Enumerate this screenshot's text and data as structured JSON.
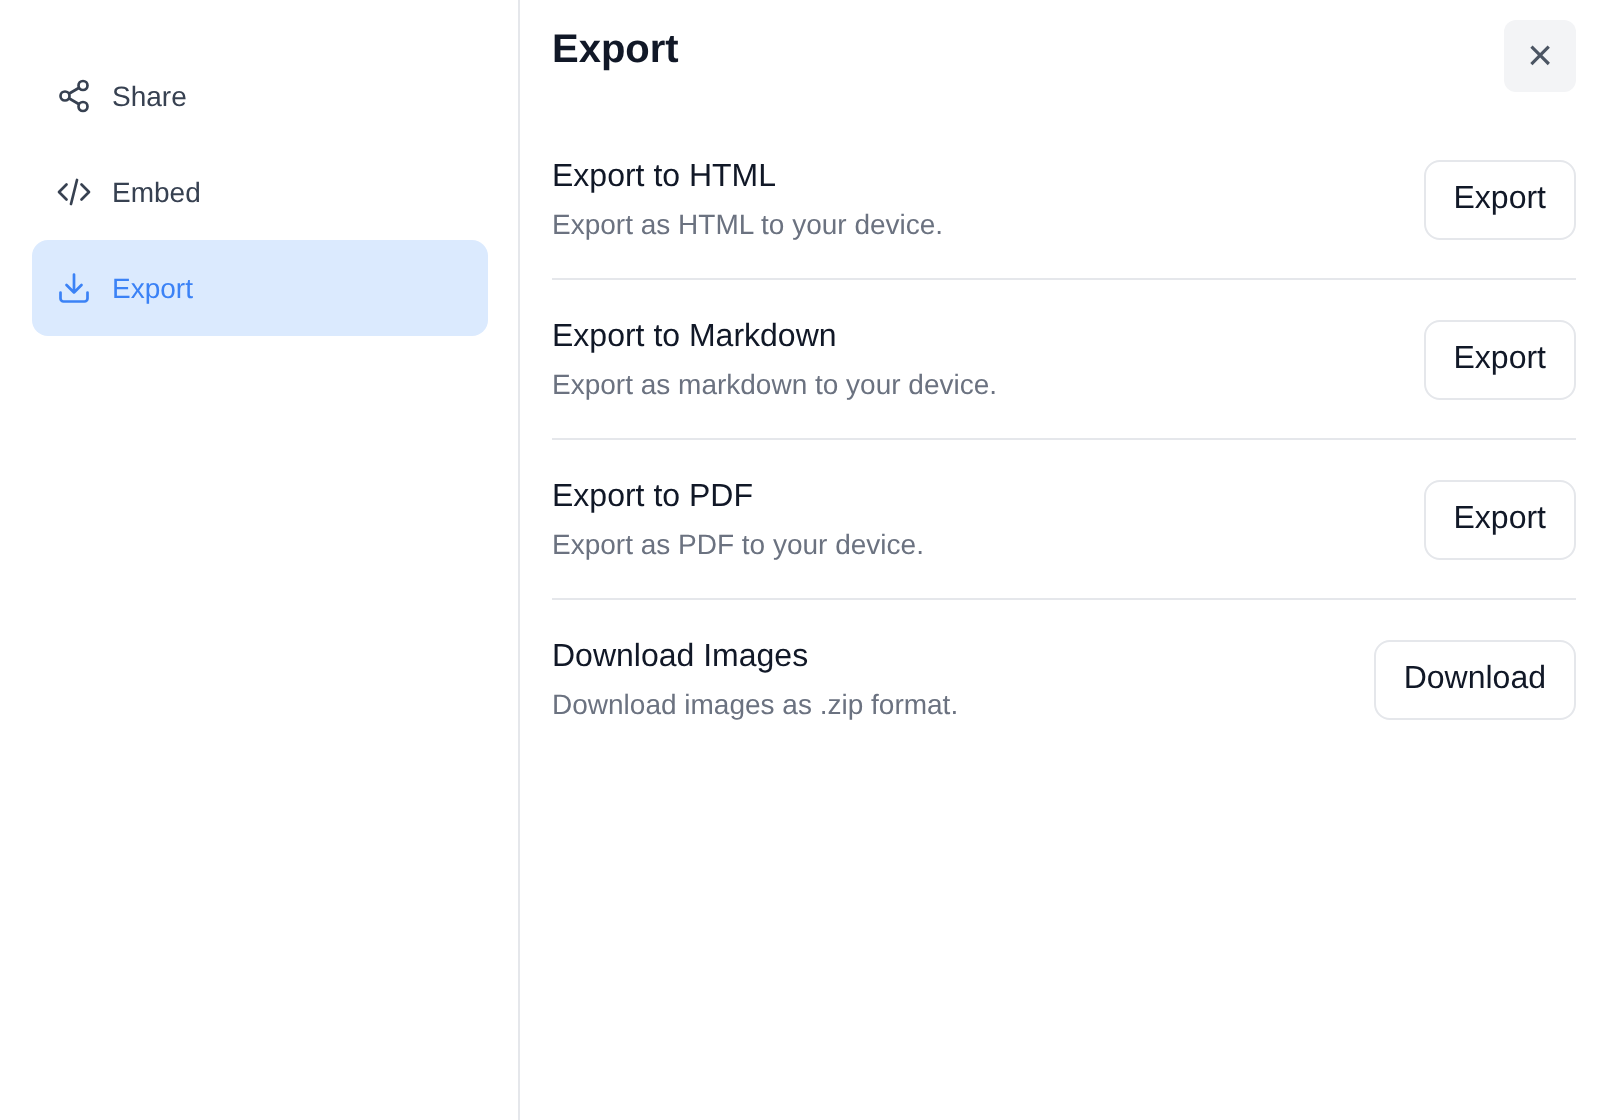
{
  "sidebar": {
    "items": [
      {
        "label": "Share",
        "kind": "share",
        "selected": false
      },
      {
        "label": "Embed",
        "kind": "embed",
        "selected": false
      },
      {
        "label": "Export",
        "kind": "download",
        "selected": true
      }
    ]
  },
  "panel": {
    "title": "Export",
    "close_label": "×",
    "rows": [
      {
        "title": "Export to HTML",
        "description": "Export as HTML to your device.",
        "button": "Export"
      },
      {
        "title": "Export to Markdown",
        "description": "Export as markdown to your device.",
        "button": "Export"
      },
      {
        "title": "Export to PDF",
        "description": "Export as PDF to your device.",
        "button": "Export"
      },
      {
        "title": "Download Images",
        "description": "Download images as .zip format.",
        "button": "Download"
      }
    ]
  }
}
